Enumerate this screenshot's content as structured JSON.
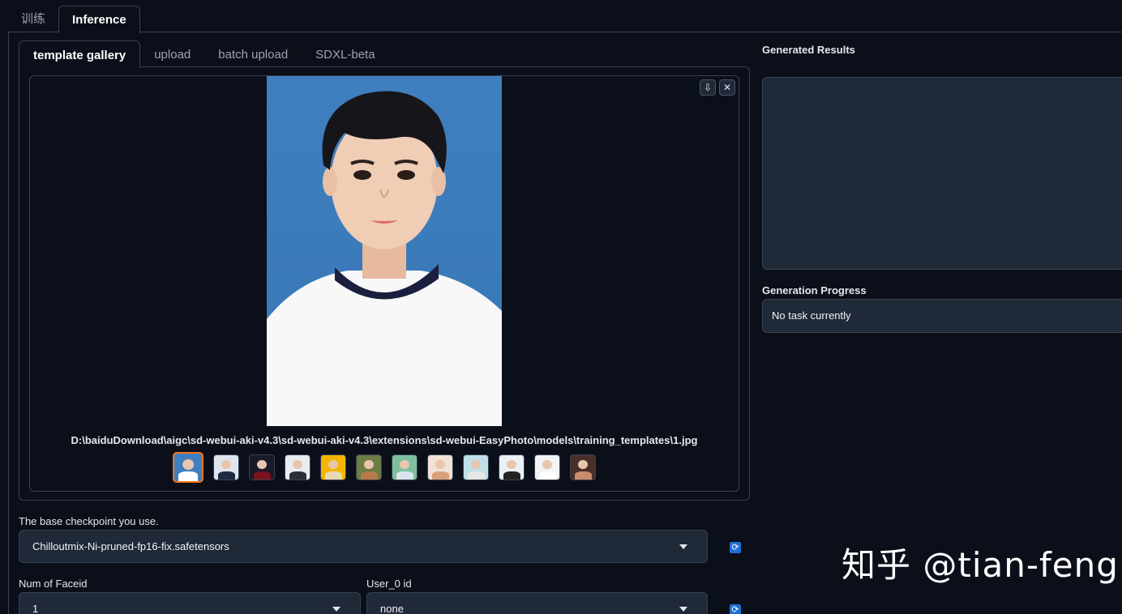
{
  "top_tabs": [
    {
      "label": "训练",
      "active": false
    },
    {
      "label": "Inference",
      "active": true
    }
  ],
  "sub_tabs": [
    {
      "label": "template gallery",
      "active": true
    },
    {
      "label": "upload",
      "active": false
    },
    {
      "label": "batch upload",
      "active": false
    },
    {
      "label": "SDXL-beta",
      "active": false
    }
  ],
  "gallery": {
    "download_icon": "download-icon",
    "close_icon": "close-icon",
    "caption": "D:\\baiduDownload\\aigc\\sd-webui-aki-v4.3\\sd-webui-aki-v4.3\\extensions\\sd-webui-EasyPhoto\\models\\training_templates\\1.jpg",
    "thumbnails": [
      {
        "bg": "#3f7fc0",
        "shirt": "#ffffff",
        "selected": true
      },
      {
        "bg": "#dfe5ee",
        "shirt": "#1f2a44",
        "selected": false
      },
      {
        "bg": "#1a1a2a",
        "shirt": "#7a1320",
        "selected": false
      },
      {
        "bg": "#e9ecf0",
        "shirt": "#2a2f3a",
        "selected": false
      },
      {
        "bg": "#f4b400",
        "shirt": "#e8d9b5",
        "selected": false
      },
      {
        "bg": "#6b7d45",
        "shirt": "#b87a4a",
        "selected": false
      },
      {
        "bg": "#7fbf9f",
        "shirt": "#d8e6ec",
        "selected": false
      },
      {
        "bg": "#f1e2d6",
        "shirt": "#d9a07a",
        "selected": false
      },
      {
        "bg": "#bfe0ea",
        "shirt": "#e6e6e6",
        "selected": false
      },
      {
        "bg": "#eceff3",
        "shirt": "#232323",
        "selected": false
      },
      {
        "bg": "#f2f3f5",
        "shirt": "#ffffff",
        "selected": false
      },
      {
        "bg": "#4a2e2a",
        "shirt": "#c98d6e",
        "selected": false
      }
    ]
  },
  "checkpoint": {
    "label": "The base checkpoint you use.",
    "value": "Chilloutmix-Ni-pruned-fp16-fix.safetensors"
  },
  "faceid": {
    "label": "Num of Faceid",
    "value": "1"
  },
  "user0": {
    "label": "User_0 id",
    "value": "none"
  },
  "right": {
    "results_label": "Generated Results",
    "progress_label": "Generation Progress",
    "progress_text": "No task currently"
  },
  "watermark": "知乎 @tian-feng",
  "colors": {
    "background": "#0b0f19",
    "panel": "#1f2937",
    "border": "#374151",
    "accent_selected": "#f97316",
    "refresh_button": "#1d6fd1"
  }
}
